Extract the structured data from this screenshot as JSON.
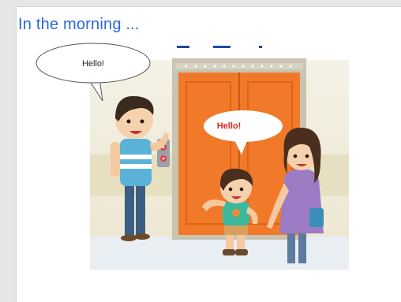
{
  "heading": "In the morning ...",
  "bubbles": {
    "left": "Hello!",
    "center": "Hello!"
  },
  "colors": {
    "heading": "#2a68d8",
    "elevator_door": "#f07a2a",
    "speech_red": "#e02020"
  }
}
